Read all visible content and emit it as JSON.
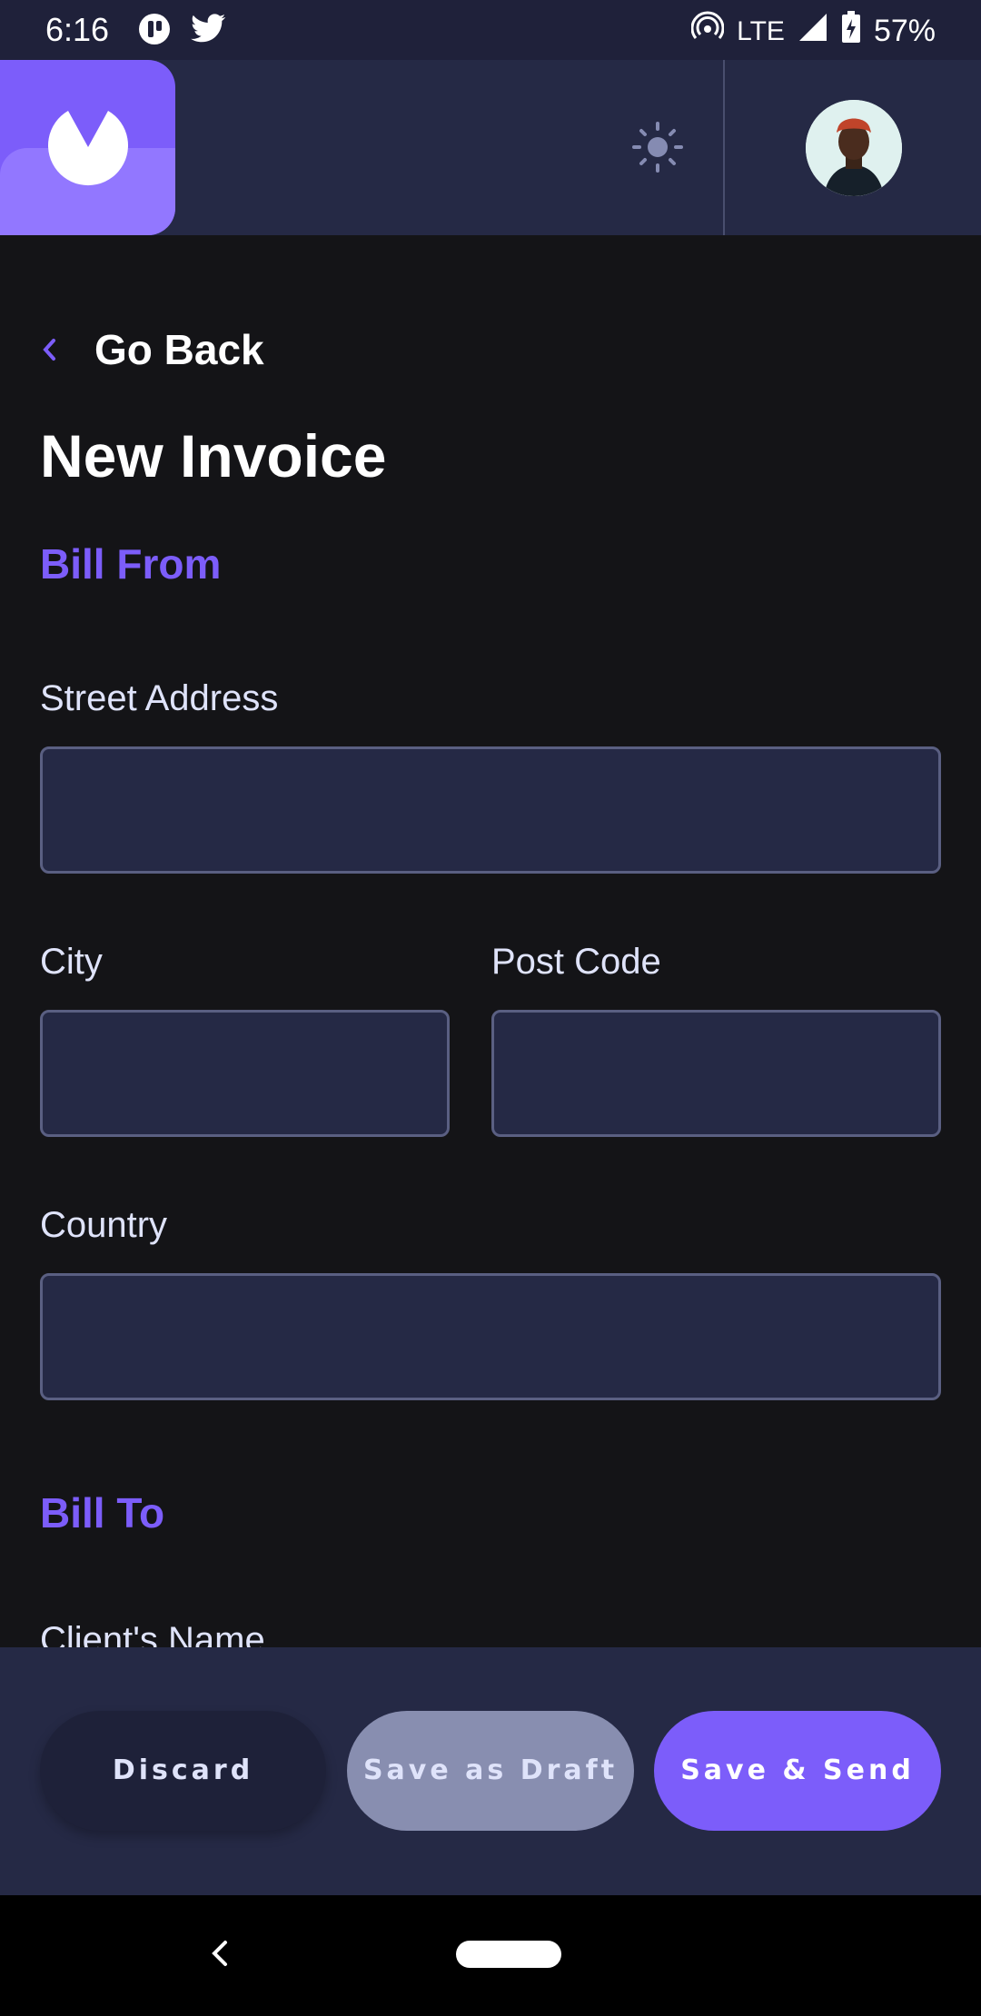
{
  "status_bar": {
    "time": "6:16",
    "network": "LTE",
    "battery": "57%"
  },
  "header": {
    "logo": "invoice-app-logo",
    "theme_icon": "sun-icon"
  },
  "nav": {
    "go_back": "Go Back"
  },
  "page": {
    "title": "New Invoice"
  },
  "bill_from": {
    "heading": "Bill From",
    "street_label": "Street Address",
    "street_value": "",
    "city_label": "City",
    "city_value": "",
    "postcode_label": "Post Code",
    "postcode_value": "",
    "country_label": "Country",
    "country_value": ""
  },
  "bill_to": {
    "heading": "Bill To",
    "client_name_label": "Client's Name"
  },
  "actions": {
    "discard": "Discard",
    "save_draft": "Save as Draft",
    "save_send": "Save & Send"
  },
  "colors": {
    "accent": "#7c5dfa",
    "header_bg": "#252945",
    "page_bg": "#141417",
    "draft_button": "#888eb0"
  }
}
